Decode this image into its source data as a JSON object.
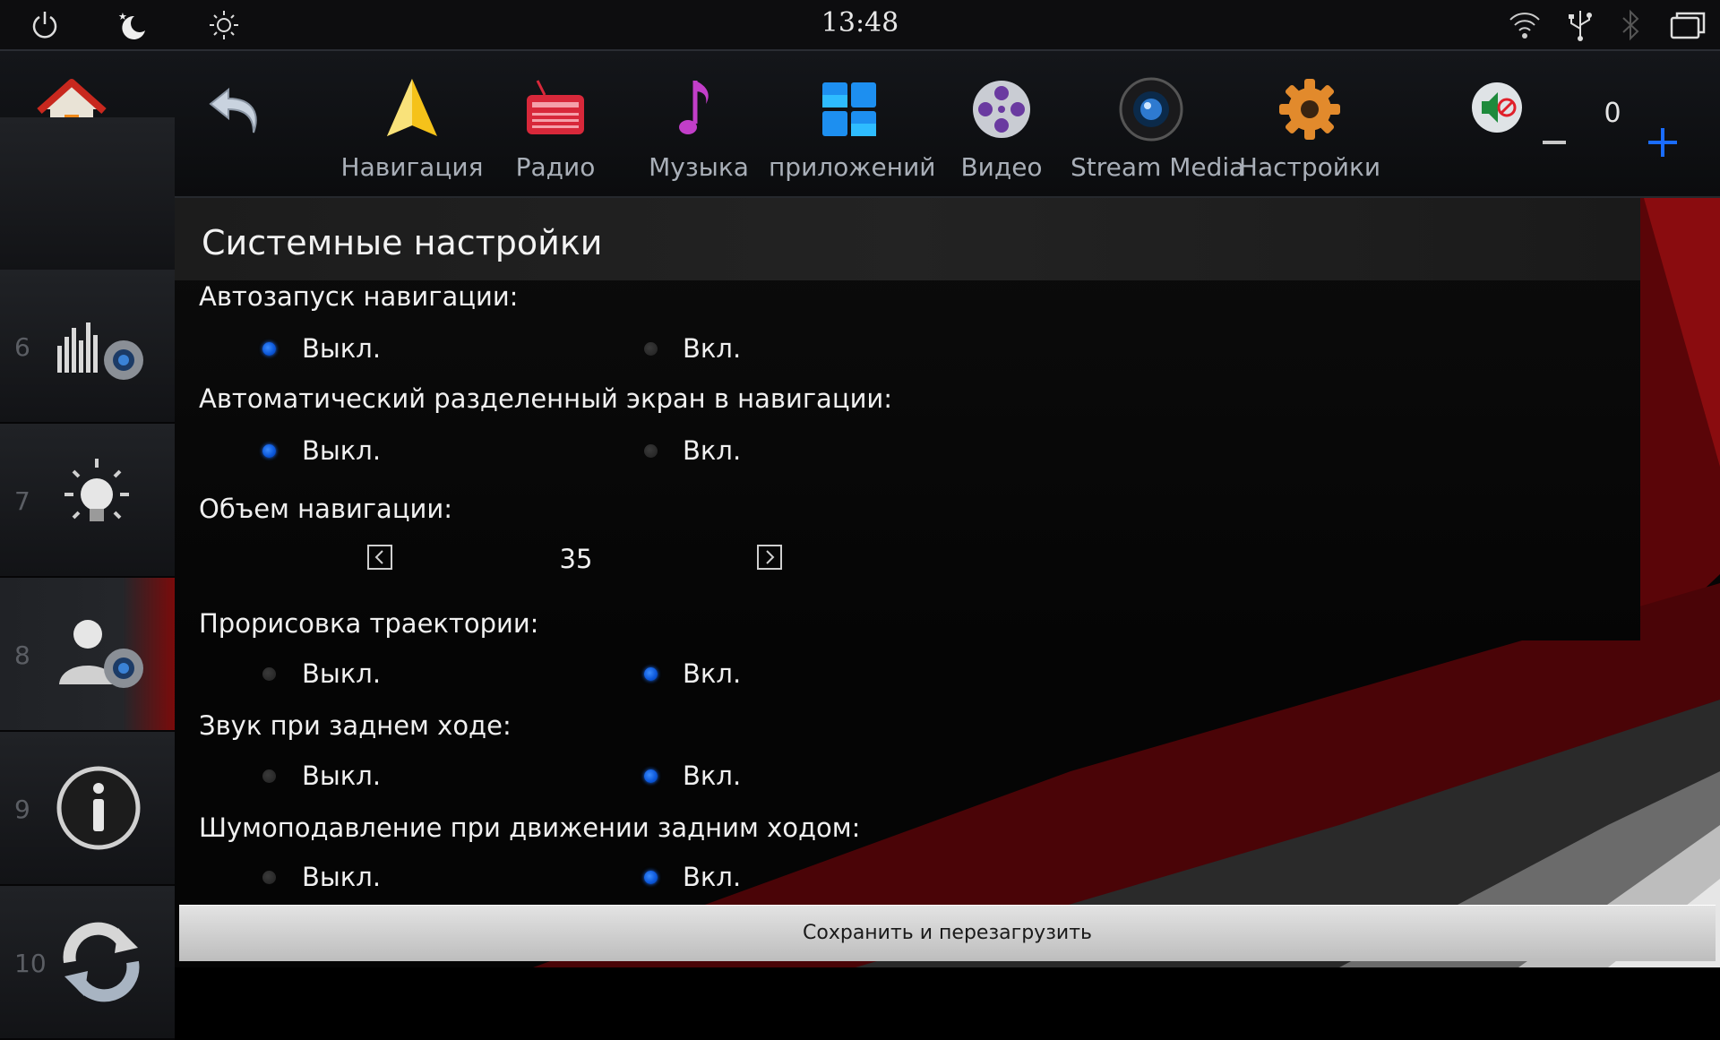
{
  "status_bar": {
    "time": "13:48",
    "icons": [
      "power-icon",
      "night-mode-icon",
      "brightness-icon",
      "wifi-icon",
      "usb-icon",
      "bluetooth-icon",
      "window-switch-icon"
    ]
  },
  "launcher": {
    "apps": [
      {
        "id": "home",
        "label": "",
        "icon": "home-icon"
      },
      {
        "id": "back",
        "label": "",
        "icon": "back-icon"
      },
      {
        "id": "navigation",
        "label": "Навигация",
        "icon": "navigation-icon"
      },
      {
        "id": "radio",
        "label": "Радио",
        "icon": "radio-icon"
      },
      {
        "id": "music",
        "label": "Музыка",
        "icon": "music-icon"
      },
      {
        "id": "apps",
        "label": "приложений",
        "icon": "apps-icon"
      },
      {
        "id": "video",
        "label": "Видео",
        "icon": "video-icon"
      },
      {
        "id": "stream",
        "label": "Stream Media",
        "icon": "stream-media-icon"
      },
      {
        "id": "settings",
        "label": "Настройки",
        "icon": "settings-icon"
      }
    ],
    "volume": {
      "value": "0",
      "mute_icon": "speaker-mute-icon"
    }
  },
  "sidebar": {
    "items": [
      {
        "num": "6",
        "icon": "equalizer-settings-icon"
      },
      {
        "num": "7",
        "icon": "lightbulb-icon"
      },
      {
        "num": "8",
        "icon": "user-settings-icon",
        "active": true
      },
      {
        "num": "9",
        "icon": "info-icon"
      },
      {
        "num": "10",
        "icon": "refresh-icon"
      }
    ]
  },
  "settings": {
    "title": "Системные настройки",
    "off_label": "Выкл.",
    "on_label": "Вкл.",
    "nav_autostart": {
      "label": "Автозапуск навигации:",
      "value": "off"
    },
    "auto_split": {
      "label": "Автоматический разделенный экран в навигации:",
      "value": "off"
    },
    "nav_volume": {
      "label": "Объем навигации:",
      "value": "35"
    },
    "trajectory": {
      "label": "Прорисовка траектории:",
      "value": "on"
    },
    "reverse_sound": {
      "label": "Звук при заднем ходе:",
      "value": "on"
    },
    "reverse_mute": {
      "label": "Шумоподавление при движении задним ходом:",
      "value": "on"
    },
    "save_label": "Сохранить и перезагрузить"
  },
  "colors": {
    "accent": "#1a6cff",
    "radio_on": "#0a55d8",
    "active_tab": "#7a0b0b"
  }
}
